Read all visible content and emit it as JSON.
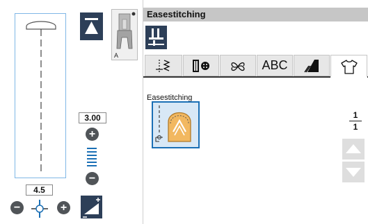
{
  "title_bar": {
    "title": "Easestitching"
  },
  "left_panel": {
    "foot_letter": "A",
    "stitch_length": "3.00",
    "stitch_width": "4.5"
  },
  "tabs": [
    {
      "id": "utility",
      "icon": "utility-stitch-icon"
    },
    {
      "id": "buttonhole",
      "icon": "buttonhole-icon"
    },
    {
      "id": "decorative",
      "icon": "decorative-stitch-icon"
    },
    {
      "id": "alphabet",
      "label": "ABC"
    },
    {
      "id": "satin",
      "icon": "satin-stitch-icon"
    },
    {
      "id": "garment",
      "icon": "garment-icon",
      "active": true
    }
  ],
  "category": {
    "label": "Easestitching",
    "stitches": [
      {
        "icon": "easestitch-sleeve-icon",
        "selected": true
      }
    ]
  },
  "pagination": {
    "current": "1",
    "total": "1"
  },
  "colors": {
    "dark_button": "#2d3f58",
    "accent_blue": "#1a6fb5",
    "title_bar": "#c6c6c6"
  }
}
